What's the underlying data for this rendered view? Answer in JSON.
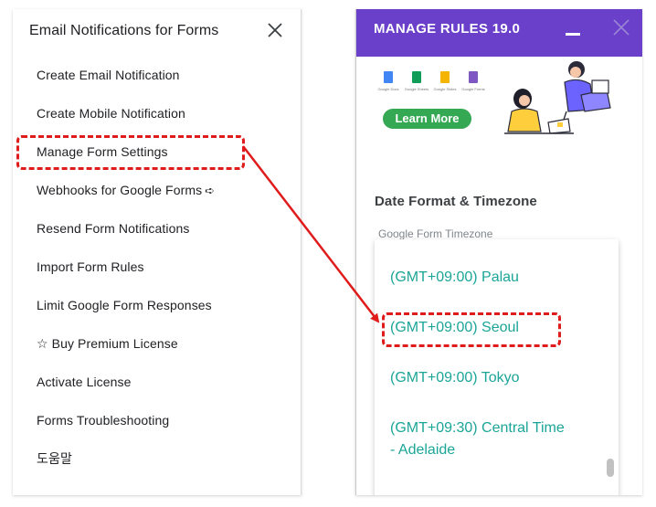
{
  "menu": {
    "title": "Email Notifications for Forms",
    "close_icon": "close-icon",
    "items": [
      {
        "label": "Create Email Notification"
      },
      {
        "label": "Create Mobile Notification"
      },
      {
        "label": "Manage Form Settings"
      },
      {
        "label": "Webhooks for Google Forms",
        "suffix": "➪"
      },
      {
        "label": "Resend Form Notifications"
      },
      {
        "label": "Import Form Rules"
      },
      {
        "label": "Limit Google Form Responses"
      },
      {
        "label": "☆ Buy Premium License"
      },
      {
        "label": "Activate License"
      },
      {
        "label": "Forms Troubleshooting"
      },
      {
        "label": "도움말"
      }
    ]
  },
  "addon": {
    "title": "MANAGE RULES 19.0",
    "header_color": "#6a3fc9",
    "app_icons": [
      {
        "label": "Google Docs",
        "color": "#4285f4"
      },
      {
        "label": "Google Sheets",
        "color": "#0f9d58"
      },
      {
        "label": "Google Slides",
        "color": "#f4b400"
      },
      {
        "label": "Google Forms",
        "color": "#7e57c2"
      }
    ],
    "learn_more": "Learn More",
    "section_title": "Date Format & Timezone",
    "timezone_label": "Google Form Timezone",
    "timezone_options": [
      {
        "line1": "(GMT+09:00) Palau",
        "line2": ""
      },
      {
        "line1": "(GMT+09:00) Seoul",
        "line2": ""
      },
      {
        "line1": "(GMT+09:00) Tokyo",
        "line2": ""
      },
      {
        "line1": "(GMT+09:30) Central Time",
        "line2": "- Adelaide"
      }
    ],
    "option_color": "#1ba597"
  },
  "annotation_color": "#e01b1b"
}
